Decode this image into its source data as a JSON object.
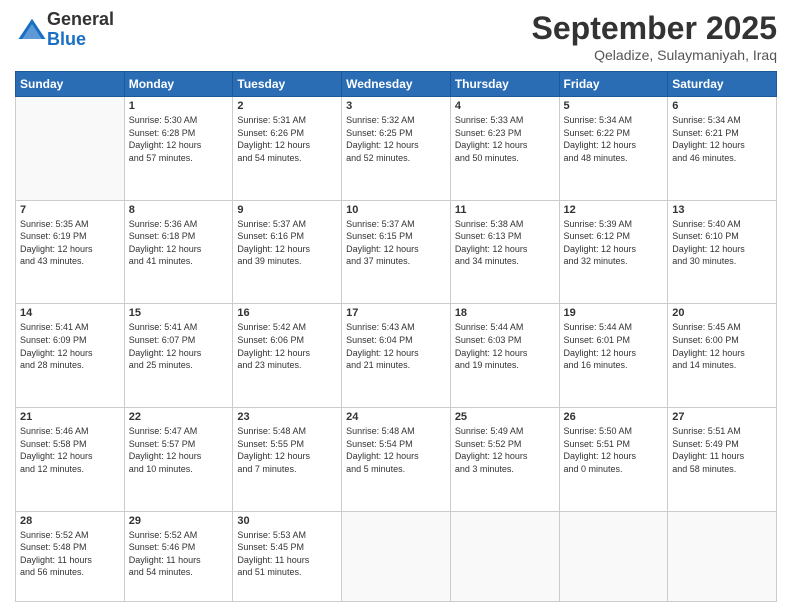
{
  "header": {
    "logo": {
      "line1": "General",
      "line2": "Blue"
    },
    "title": "September 2025",
    "subtitle": "Qeladize, Sulaymaniyah, Iraq"
  },
  "weekdays": [
    "Sunday",
    "Monday",
    "Tuesday",
    "Wednesday",
    "Thursday",
    "Friday",
    "Saturday"
  ],
  "weeks": [
    [
      {
        "day": "",
        "info": ""
      },
      {
        "day": "1",
        "info": "Sunrise: 5:30 AM\nSunset: 6:28 PM\nDaylight: 12 hours\nand 57 minutes."
      },
      {
        "day": "2",
        "info": "Sunrise: 5:31 AM\nSunset: 6:26 PM\nDaylight: 12 hours\nand 54 minutes."
      },
      {
        "day": "3",
        "info": "Sunrise: 5:32 AM\nSunset: 6:25 PM\nDaylight: 12 hours\nand 52 minutes."
      },
      {
        "day": "4",
        "info": "Sunrise: 5:33 AM\nSunset: 6:23 PM\nDaylight: 12 hours\nand 50 minutes."
      },
      {
        "day": "5",
        "info": "Sunrise: 5:34 AM\nSunset: 6:22 PM\nDaylight: 12 hours\nand 48 minutes."
      },
      {
        "day": "6",
        "info": "Sunrise: 5:34 AM\nSunset: 6:21 PM\nDaylight: 12 hours\nand 46 minutes."
      }
    ],
    [
      {
        "day": "7",
        "info": "Sunrise: 5:35 AM\nSunset: 6:19 PM\nDaylight: 12 hours\nand 43 minutes."
      },
      {
        "day": "8",
        "info": "Sunrise: 5:36 AM\nSunset: 6:18 PM\nDaylight: 12 hours\nand 41 minutes."
      },
      {
        "day": "9",
        "info": "Sunrise: 5:37 AM\nSunset: 6:16 PM\nDaylight: 12 hours\nand 39 minutes."
      },
      {
        "day": "10",
        "info": "Sunrise: 5:37 AM\nSunset: 6:15 PM\nDaylight: 12 hours\nand 37 minutes."
      },
      {
        "day": "11",
        "info": "Sunrise: 5:38 AM\nSunset: 6:13 PM\nDaylight: 12 hours\nand 34 minutes."
      },
      {
        "day": "12",
        "info": "Sunrise: 5:39 AM\nSunset: 6:12 PM\nDaylight: 12 hours\nand 32 minutes."
      },
      {
        "day": "13",
        "info": "Sunrise: 5:40 AM\nSunset: 6:10 PM\nDaylight: 12 hours\nand 30 minutes."
      }
    ],
    [
      {
        "day": "14",
        "info": "Sunrise: 5:41 AM\nSunset: 6:09 PM\nDaylight: 12 hours\nand 28 minutes."
      },
      {
        "day": "15",
        "info": "Sunrise: 5:41 AM\nSunset: 6:07 PM\nDaylight: 12 hours\nand 25 minutes."
      },
      {
        "day": "16",
        "info": "Sunrise: 5:42 AM\nSunset: 6:06 PM\nDaylight: 12 hours\nand 23 minutes."
      },
      {
        "day": "17",
        "info": "Sunrise: 5:43 AM\nSunset: 6:04 PM\nDaylight: 12 hours\nand 21 minutes."
      },
      {
        "day": "18",
        "info": "Sunrise: 5:44 AM\nSunset: 6:03 PM\nDaylight: 12 hours\nand 19 minutes."
      },
      {
        "day": "19",
        "info": "Sunrise: 5:44 AM\nSunset: 6:01 PM\nDaylight: 12 hours\nand 16 minutes."
      },
      {
        "day": "20",
        "info": "Sunrise: 5:45 AM\nSunset: 6:00 PM\nDaylight: 12 hours\nand 14 minutes."
      }
    ],
    [
      {
        "day": "21",
        "info": "Sunrise: 5:46 AM\nSunset: 5:58 PM\nDaylight: 12 hours\nand 12 minutes."
      },
      {
        "day": "22",
        "info": "Sunrise: 5:47 AM\nSunset: 5:57 PM\nDaylight: 12 hours\nand 10 minutes."
      },
      {
        "day": "23",
        "info": "Sunrise: 5:48 AM\nSunset: 5:55 PM\nDaylight: 12 hours\nand 7 minutes."
      },
      {
        "day": "24",
        "info": "Sunrise: 5:48 AM\nSunset: 5:54 PM\nDaylight: 12 hours\nand 5 minutes."
      },
      {
        "day": "25",
        "info": "Sunrise: 5:49 AM\nSunset: 5:52 PM\nDaylight: 12 hours\nand 3 minutes."
      },
      {
        "day": "26",
        "info": "Sunrise: 5:50 AM\nSunset: 5:51 PM\nDaylight: 12 hours\nand 0 minutes."
      },
      {
        "day": "27",
        "info": "Sunrise: 5:51 AM\nSunset: 5:49 PM\nDaylight: 11 hours\nand 58 minutes."
      }
    ],
    [
      {
        "day": "28",
        "info": "Sunrise: 5:52 AM\nSunset: 5:48 PM\nDaylight: 11 hours\nand 56 minutes."
      },
      {
        "day": "29",
        "info": "Sunrise: 5:52 AM\nSunset: 5:46 PM\nDaylight: 11 hours\nand 54 minutes."
      },
      {
        "day": "30",
        "info": "Sunrise: 5:53 AM\nSunset: 5:45 PM\nDaylight: 11 hours\nand 51 minutes."
      },
      {
        "day": "",
        "info": ""
      },
      {
        "day": "",
        "info": ""
      },
      {
        "day": "",
        "info": ""
      },
      {
        "day": "",
        "info": ""
      }
    ]
  ]
}
